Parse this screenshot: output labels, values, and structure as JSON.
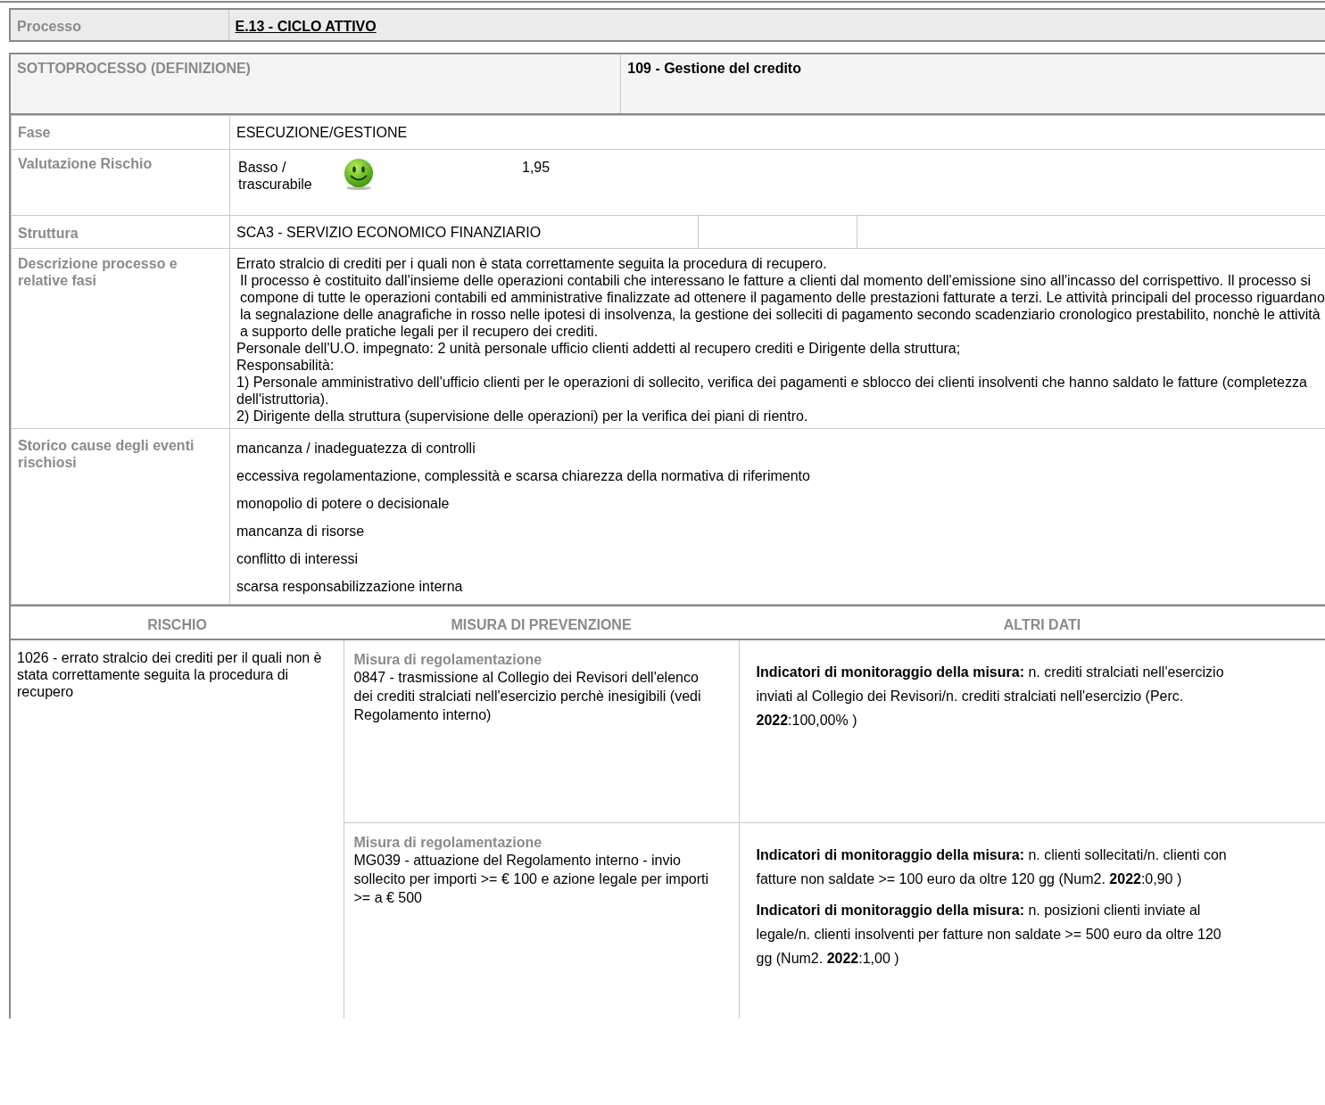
{
  "processo": {
    "label": "Processo",
    "value": "E.13 - CICLO ATTIVO"
  },
  "sottoprocesso": {
    "label": "SOTTOPROCESSO (DEFINIZIONE)",
    "value": "109 - Gestione del credito"
  },
  "fase": {
    "label": "Fase",
    "value": "ESECUZIONE/GESTIONE"
  },
  "valutazione": {
    "label": "Valutazione Rischio",
    "level_text": "Basso / trascurabile",
    "score": "1,95"
  },
  "struttura": {
    "label": "Struttura",
    "value": "SCA3 - SERVIZIO ECONOMICO FINANZIARIO"
  },
  "descrizione": {
    "label": "Descrizione processo e relative fasi",
    "paragraphs": [
      "Errato stralcio di crediti per i quali non è stata correttamente seguita la procedura di recupero.",
      "Il processo è costituito dall'insieme delle operazioni contabili che interessano le fatture a clienti dal momento dell'emissione sino all'incasso del corrispettivo. Il processo si compone di tutte le operazioni contabili ed amministrative finalizzate ad ottenere il pagamento delle prestazioni fatturate a terzi. Le attività principali del processo riguardano la segnalazione delle anagrafiche in rosso nelle ipotesi di insolvenza, la gestione dei solleciti di pagamento secondo scadenziario cronologico prestabilito, nonchè le attività a supporto delle pratiche legali per il recupero dei crediti.",
      "Personale dell'U.O. impegnato: 2 unità personale ufficio clienti addetti al recupero crediti e Dirigente della struttura;",
      "Responsabilità:",
      "1) Personale amministrativo dell'ufficio clienti per le operazioni di sollecito, verifica dei pagamenti e sblocco dei clienti insolventi che hanno saldato le fatture (completezza dell'istruttoria).",
      "2) Dirigente della struttura (supervisione delle operazioni) per la verifica dei piani di rientro."
    ]
  },
  "storico": {
    "label": "Storico cause degli eventi rischiosi",
    "items": [
      "mancanza / inadeguatezza di controlli",
      "eccessiva regolamentazione, complessità e scarsa chiarezza della normativa di riferimento",
      "monopolio di potere o decisionale",
      "mancanza di risorse",
      "conflitto di interessi",
      "scarsa responsabilizzazione interna"
    ]
  },
  "columns": [
    "RISCHIO",
    "MISURA DI PREVENZIONE",
    "ALTRI DATI"
  ],
  "rischio": "1026 - errato stralcio dei crediti per il quali non è stata correttamente seguita la procedura di recupero",
  "misure": [
    {
      "type": "Misura di regolamentazione",
      "text": "0847 - trasmissione al Collegio dei Revisori dell'elenco dei crediti stralciati nell'esercizio perchè inesigibili (vedi Regolamento interno)",
      "indicators": [
        "**Indicatori di monitoraggio della misura:** n. crediti stralciati nell'esercizio inviati al Collegio dei Revisori/n. crediti stralciati nell'esercizio (Perc. **2022**:100,00% )"
      ]
    },
    {
      "type": "Misura di regolamentazione",
      "text": "MG039 - attuazione del Regolamento interno - invio sollecito per importi >= € 100 e azione legale per importi >= a € 500",
      "indicators": [
        "**Indicatori di monitoraggio della misura:** n. clienti sollecitati/n. clienti con fatture non saldate >= 100 euro da oltre 120 gg (Num2. **2022**:0,90 )",
        "**Indicatori di monitoraggio della misura:** n. posizioni clienti inviate al legale/n. clienti insolventi per fatture non saldate >= 500 euro da oltre 120 gg (Num2. **2022**:1,00 )"
      ]
    }
  ]
}
